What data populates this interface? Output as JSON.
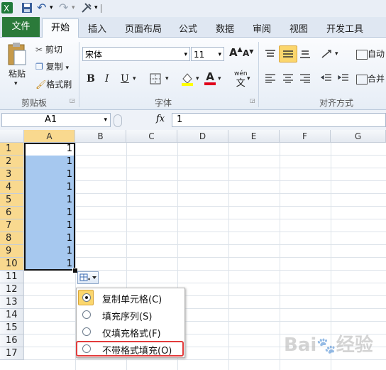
{
  "qat": {
    "undo_arrow": "↶",
    "redo_arrow": "↷",
    "dropdown": "▾"
  },
  "tabs": [
    {
      "label": "文件"
    },
    {
      "label": "开始"
    },
    {
      "label": "插入"
    },
    {
      "label": "页面布局"
    },
    {
      "label": "公式"
    },
    {
      "label": "数据"
    },
    {
      "label": "审阅"
    },
    {
      "label": "视图"
    },
    {
      "label": "开发工具"
    }
  ],
  "ribbon": {
    "clipboard": {
      "paste": "粘贴",
      "cut": "剪切",
      "copy": "复制",
      "format_painter": "格式刷",
      "group_label": "剪贴板"
    },
    "font": {
      "font_name": "宋体",
      "font_size": "11",
      "group_label": "字体",
      "bold": "B",
      "italic": "I",
      "underline": "U",
      "grow": "A",
      "shrink": "A",
      "wen": "wén",
      "wen_char": "文",
      "color_a": "A"
    },
    "alignment": {
      "group_label": "对齐方式",
      "wrap": "自动",
      "merge": "合并"
    }
  },
  "formula_bar": {
    "name_box": "A1",
    "fx": "fx",
    "value": "1"
  },
  "grid": {
    "columns": [
      "A",
      "B",
      "C",
      "D",
      "E",
      "F",
      "G"
    ],
    "rows": [
      "1",
      "2",
      "3",
      "4",
      "5",
      "6",
      "7",
      "8",
      "9",
      "10",
      "11",
      "12",
      "13",
      "14",
      "15",
      "16",
      "17"
    ],
    "a_values": [
      "1",
      "1",
      "1",
      "1",
      "1",
      "1",
      "1",
      "1",
      "1",
      "1"
    ]
  },
  "autofill_menu": {
    "items": [
      {
        "label": "复制单元格(C)",
        "selected": true
      },
      {
        "label": "填充序列(S)",
        "selected": false
      },
      {
        "label": "仅填充格式(F)",
        "selected": false
      },
      {
        "label": "不带格式填充(O)",
        "selected": false
      }
    ]
  },
  "colors": {
    "file_tab": "#2b7a3a",
    "selection": "#a6c8ef",
    "header_selected": "#f9d98f",
    "highlight_box": "#e23b3b"
  },
  "watermark": "Baidu 经验"
}
